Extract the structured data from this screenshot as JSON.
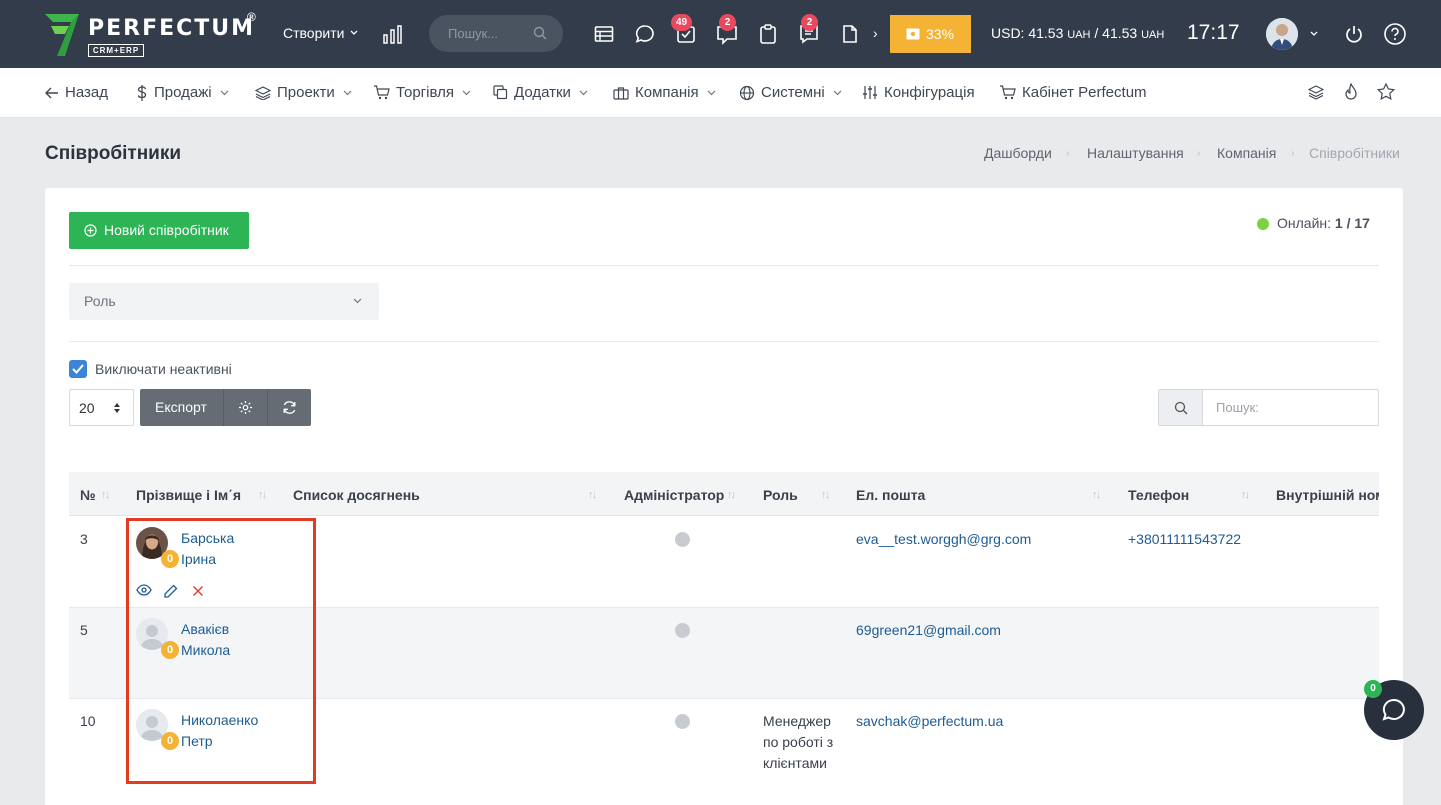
{
  "colors": {
    "topbar": "#323c4a",
    "accent_green": "#2cb455",
    "badge_red": "#e74a5f",
    "progress": "#f5b335",
    "link": "#1e5c92",
    "highlight": "#e23b23"
  },
  "topbar": {
    "logo": "PERFECTUM",
    "logo_reg": "®",
    "logo_sub": "CRM+ERP",
    "create_label": "Створити",
    "search_placeholder": "Пошук...",
    "badges": {
      "tasks": "49",
      "feedback": "2",
      "notes": "2"
    },
    "progress": "33%",
    "currency_usd_label": "USD: 41.53",
    "currency_usd_unit": "UAH",
    "currency_sep": "/",
    "currency_val2": "41.53",
    "currency_unit2": "UAH",
    "time": "17:17",
    "more_arrow": "›"
  },
  "navbar": {
    "back": "Назад",
    "sales": "Продажі",
    "projects": "Проекти",
    "trade": "Торгівля",
    "addons": "Додатки",
    "company": "Компанія",
    "system": "Системні",
    "config": "Конфігурація",
    "cabinet": "Кабінет Perfectum"
  },
  "page": {
    "title": "Співробітники",
    "breadcrumb": [
      "Дашборди",
      "Налаштування",
      "Компанія",
      "Співробітники"
    ]
  },
  "controls": {
    "new_employee": "Новий співробітник",
    "online_label": "Онлайн:",
    "online_value": "1 / 17",
    "role_placeholder": "Роль",
    "exclude_inactive": "Виключати неактивні",
    "per_page": "20",
    "export": "Експорт",
    "search_placeholder": "Пошук:"
  },
  "table": {
    "headers": {
      "num": "№",
      "name": "Прізвище і Ім΄я",
      "achievements": "Список досягнень",
      "admin": "Адміністратор",
      "role": "Роль",
      "email": "Ел. пошта",
      "phone": "Телефон",
      "internal": "Внутрішній ном"
    },
    "rows": [
      {
        "num": "3",
        "last": "Барська",
        "first": "Ірина",
        "points": "0",
        "email": "eva__test.worggh@grg.com",
        "phone": "+38011111543722",
        "role": ""
      },
      {
        "num": "5",
        "last": "Авакієв",
        "first": "Микола",
        "points": "0",
        "email": "69green21@gmail.com",
        "phone": "",
        "role": ""
      },
      {
        "num": "10",
        "last": "Николаенко",
        "first": "Петр",
        "points": "0",
        "email": "savchak@perfectum.ua",
        "phone": "",
        "role": "Менеджер по роботі з клієнтами"
      }
    ]
  },
  "chat": {
    "badge": "0"
  }
}
